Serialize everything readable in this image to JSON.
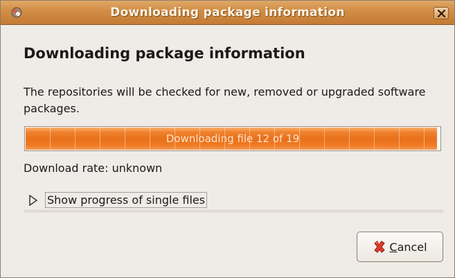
{
  "window": {
    "title": "Downloading package information"
  },
  "content": {
    "heading": "Downloading package information",
    "description": "The repositories will be checked for new, removed or upgraded software packages.",
    "progress": {
      "text": "Downloading file 12 of 19",
      "fraction": 0.993
    },
    "rate": "Download rate: unknown",
    "expander_label": "Show progress of single files"
  },
  "buttons": {
    "cancel_label": "Cancel",
    "cancel_mnemonic": "C"
  },
  "colors": {
    "titlebar": "#d18c44",
    "progress": "#e8701b",
    "background": "#efebe7"
  }
}
